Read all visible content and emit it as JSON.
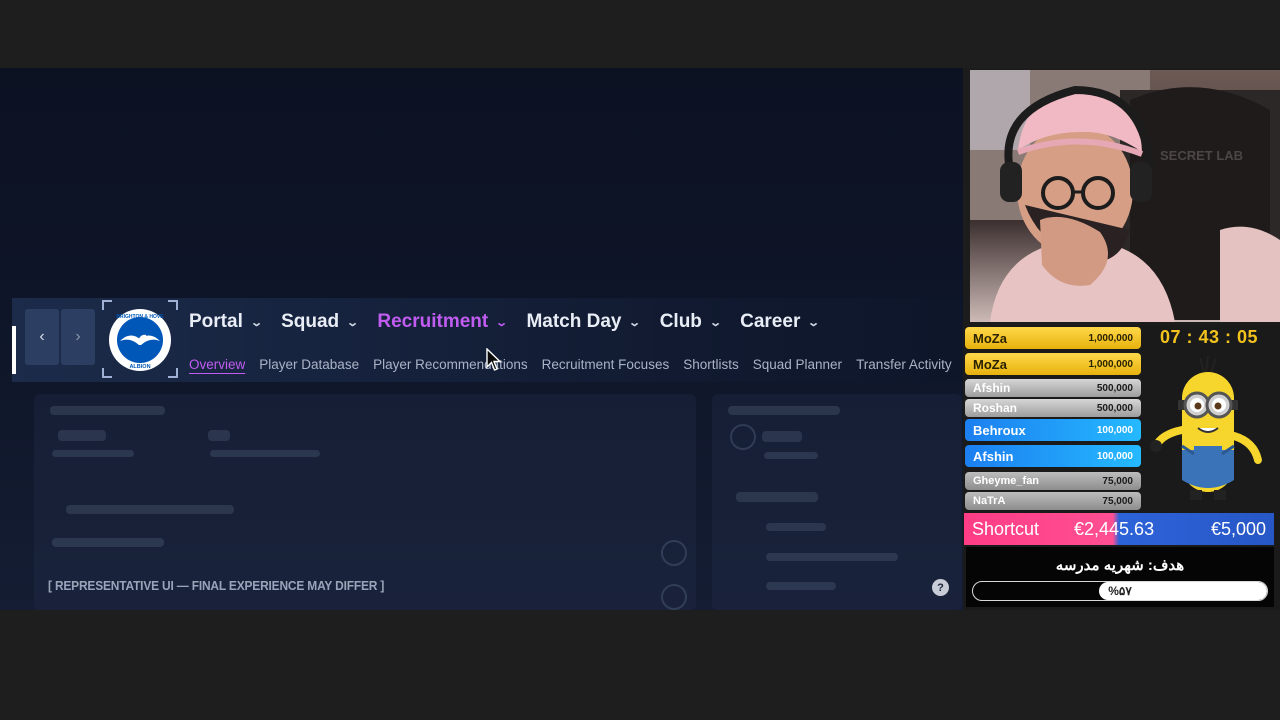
{
  "nav": {
    "back_icon": "chevron-left-icon",
    "forward_icon": "chevron-right-icon",
    "crest_name": "brighton-crest",
    "crest_top_text": "BRIGHTON & HOVE",
    "crest_bottom_text": "ALBION",
    "menu": [
      {
        "label": "Portal",
        "active": false
      },
      {
        "label": "Squad",
        "active": false
      },
      {
        "label": "Recruitment",
        "active": true
      },
      {
        "label": "Match Day",
        "active": false
      },
      {
        "label": "Club",
        "active": false
      },
      {
        "label": "Career",
        "active": false
      }
    ],
    "submenu": [
      {
        "label": "Overview",
        "active": true
      },
      {
        "label": "Player Database",
        "active": false
      },
      {
        "label": "Player Recommendations",
        "active": false
      },
      {
        "label": "Recruitment Focuses",
        "active": false
      },
      {
        "label": "Shortlists",
        "active": false
      },
      {
        "label": "Squad Planner",
        "active": false
      },
      {
        "label": "Transfer Activity",
        "active": false
      }
    ]
  },
  "disclaimer": "[ REPRESENTATIVE UI — FINAL EXPERIENCE MAY DIFFER ]",
  "stream": {
    "timer": "07 : 43 : 05",
    "donations": [
      {
        "name": "MoZa",
        "amount": "1,000,000",
        "tier": "gold"
      },
      {
        "name": "MoZa",
        "amount": "1,000,000",
        "tier": "gold"
      },
      {
        "name": "Afshin",
        "amount": "500,000",
        "tier": "silver"
      },
      {
        "name": "Roshan",
        "amount": "500,000",
        "tier": "silver"
      },
      {
        "name": "Behroux",
        "amount": "100,000",
        "tier": "blue"
      },
      {
        "name": "Afshin",
        "amount": "100,000",
        "tier": "blue"
      },
      {
        "name": "Gheyme_fan",
        "amount": "75,000",
        "tier": "gray"
      },
      {
        "name": "NaTrA",
        "amount": "75,000",
        "tier": "gray"
      }
    ],
    "shortcut": {
      "label": "Shortcut",
      "current": "€2,445.63",
      "goal": "€5,000"
    },
    "goal": {
      "title": "هدف: شهریه مدرسه",
      "percent_text": "%۵۷",
      "progress": 0.57
    },
    "webcam_text": "SECRET LAB"
  },
  "colors": {
    "accent": "#c05cf0",
    "timer": "#f2c31d",
    "gold": "#ffd84a",
    "blue": "#25b9ff",
    "pink": "#ff4f92"
  }
}
